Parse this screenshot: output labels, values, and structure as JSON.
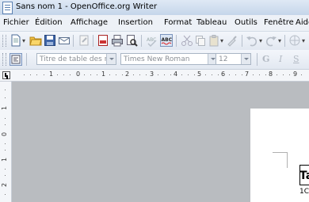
{
  "window": {
    "title": "Sans nom 1 - OpenOffice.org Writer"
  },
  "menu": {
    "items": [
      "Fichier",
      "Édition",
      "Affichage",
      "Insertion",
      "Format",
      "Tableau",
      "Outils",
      "Fenêtre",
      "Aide"
    ]
  },
  "formatting": {
    "style_value": "Titre de table des mat",
    "font_value": "Times New Roman",
    "size_value": "12",
    "bold_glyph": "G",
    "italic_glyph": "I",
    "underline_glyph": "S"
  },
  "ruler": {
    "marks": [
      "1",
      "0",
      "1",
      "2",
      "3",
      "4",
      "5",
      "6",
      "7",
      "8",
      "9"
    ],
    "vertical_marks": [
      "1",
      "0",
      "1",
      "2"
    ]
  },
  "document": {
    "table_heading": "Ta",
    "table_cell": "1C"
  },
  "colors": {
    "titlebar": "#c5d6ea",
    "workspace": "#b9bcc0",
    "page": "#ffffff"
  }
}
